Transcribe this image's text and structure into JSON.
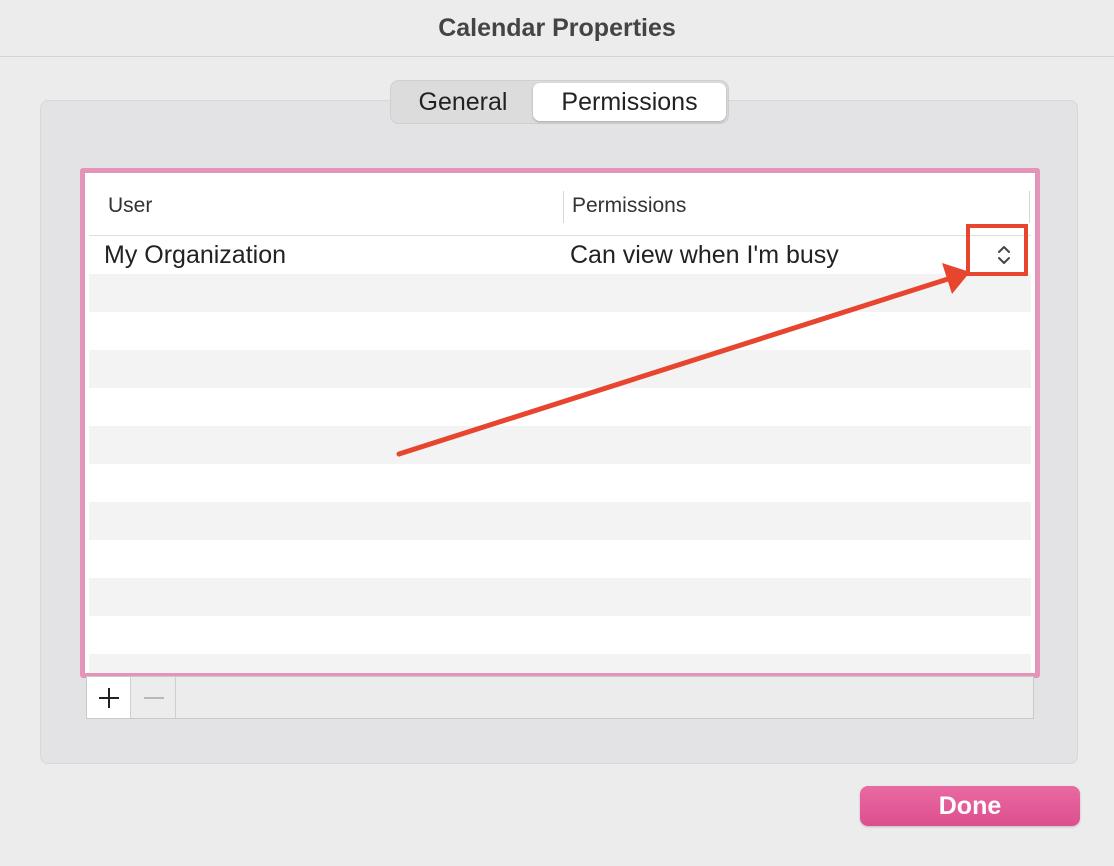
{
  "window": {
    "title": "Calendar Properties"
  },
  "tabs": [
    {
      "label": "General",
      "selected": false
    },
    {
      "label": "Permissions",
      "selected": true
    }
  ],
  "table": {
    "columns": [
      "User",
      "Permissions"
    ],
    "rows": [
      {
        "user": "My Organization",
        "permission": "Can view when I'm busy"
      }
    ],
    "empty_row_count": 11
  },
  "toolbar": {
    "add_icon": "plus-icon",
    "remove_icon": "minus-icon"
  },
  "footer": {
    "done_label": "Done"
  },
  "colors": {
    "accent": "#dc4f8e",
    "table_frame": "#e394b8",
    "annotation": "#e8452f"
  }
}
